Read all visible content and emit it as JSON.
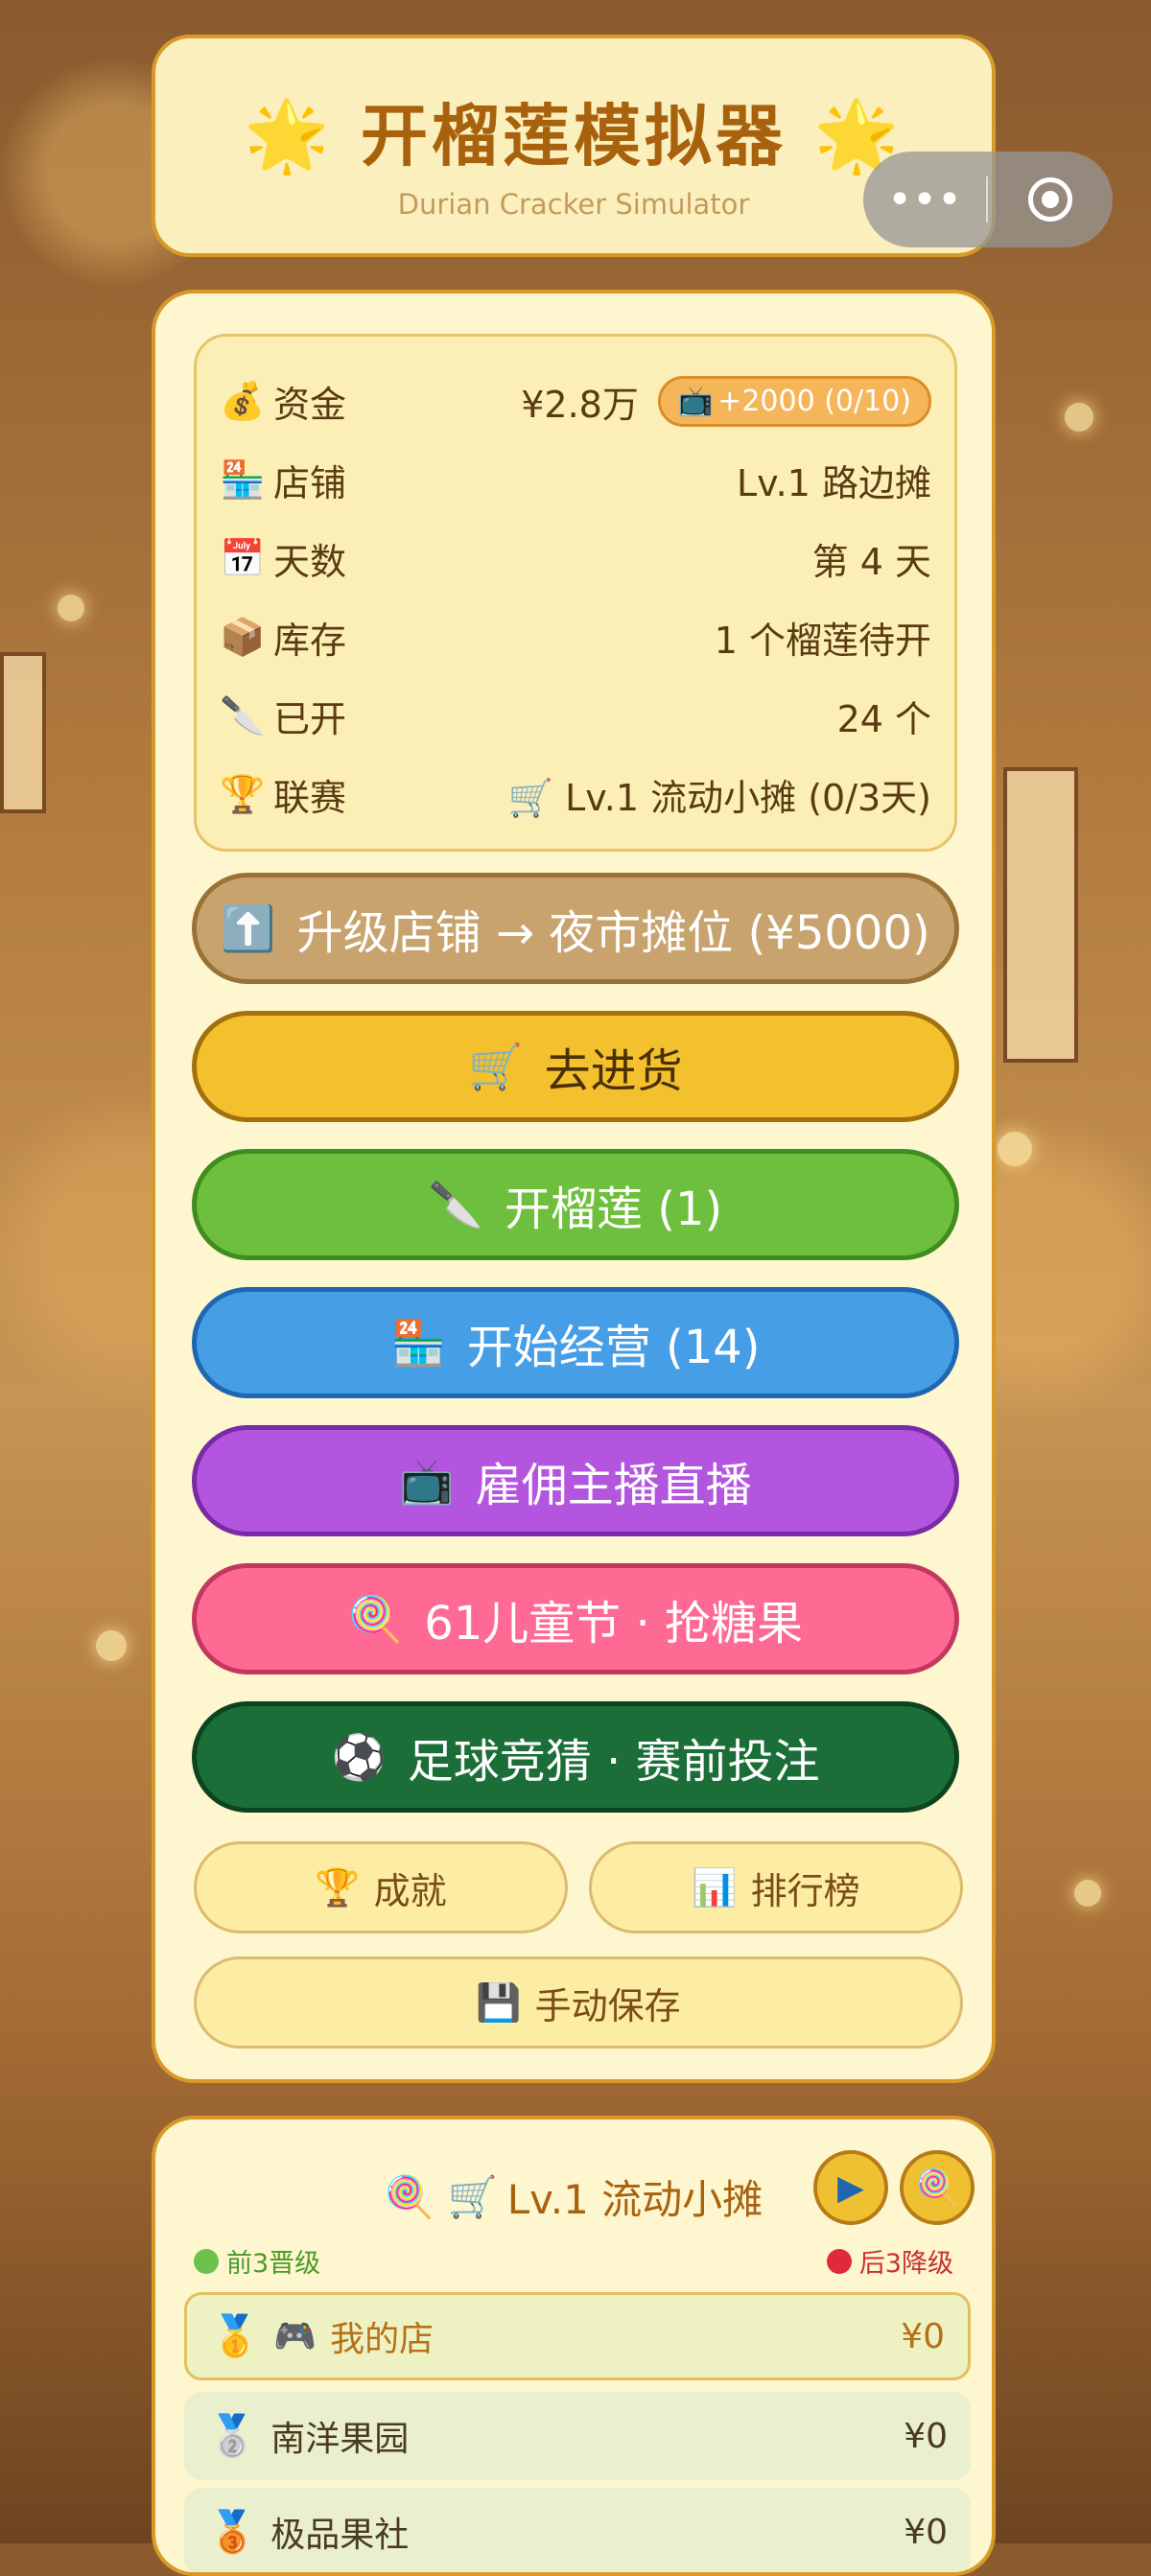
{
  "header": {
    "title": "开榴莲模拟器",
    "star": "🌟",
    "subtitle": "Durian Cracker Simulator"
  },
  "capsule": {
    "more_icon": "•••"
  },
  "stats": [
    {
      "icon": "💰",
      "label": "资金",
      "value": "¥2.8万"
    },
    {
      "icon": "🏪",
      "label": "店铺",
      "value": "Lv.1 路边摊"
    },
    {
      "icon": "📅",
      "label": "天数",
      "value": "第 4 天"
    },
    {
      "icon": "📦",
      "label": "库存",
      "value": "1 个榴莲待开"
    },
    {
      "icon": "🔪",
      "label": "已开",
      "value": "24 个"
    },
    {
      "icon": "🏆",
      "label": "联赛",
      "value": "🛒 Lv.1 流动小摊 (0/3天)"
    }
  ],
  "ad_reward": {
    "icon": "📺",
    "label": "+2000 (0/10)"
  },
  "buttons": {
    "upgrade": {
      "icon": "⬆️",
      "label": "升级店铺 → 夜市摊位 (¥5000)"
    },
    "restock": {
      "icon": "🛒",
      "label": "去进货"
    },
    "open": {
      "icon": "🔪",
      "label": "开榴莲 (1)"
    },
    "run": {
      "icon": "🏪",
      "label": "开始经营 (14)"
    },
    "live": {
      "icon": "📺",
      "label": "雇佣主播直播"
    },
    "candy": {
      "icon": "🍭",
      "label": "61儿童节 · 抢糖果"
    },
    "soccer": {
      "icon": "⚽",
      "label": "足球竞猜 · 赛前投注"
    }
  },
  "small_buttons": {
    "achievements": {
      "icon": "🏆",
      "label": "成就"
    },
    "leaderboard": {
      "icon": "📊",
      "label": "排行榜"
    },
    "save": {
      "icon": "💾",
      "label": "手动保存"
    }
  },
  "league": {
    "title_icons": "🍭 🛒",
    "title": "Lv.1 流动小摊",
    "play_icon": "▶",
    "candy_icon": "🍭",
    "promote_text": "前3晋级",
    "demote_text": "后3降级",
    "rows": [
      {
        "medal": "🥇",
        "icon": "🎮",
        "name": "我的店",
        "amount": "¥0"
      },
      {
        "medal": "🥈",
        "icon": "",
        "name": "南洋果园",
        "amount": "¥0"
      },
      {
        "medal": "🥉",
        "icon": "",
        "name": "极品果社",
        "amount": "¥0"
      }
    ]
  },
  "colors": {
    "accent": "#a8620e",
    "card_bg": "#fdf6cf",
    "card_border": "#d79a2a",
    "promote": "#4a9a2a",
    "demote": "#c83030"
  }
}
